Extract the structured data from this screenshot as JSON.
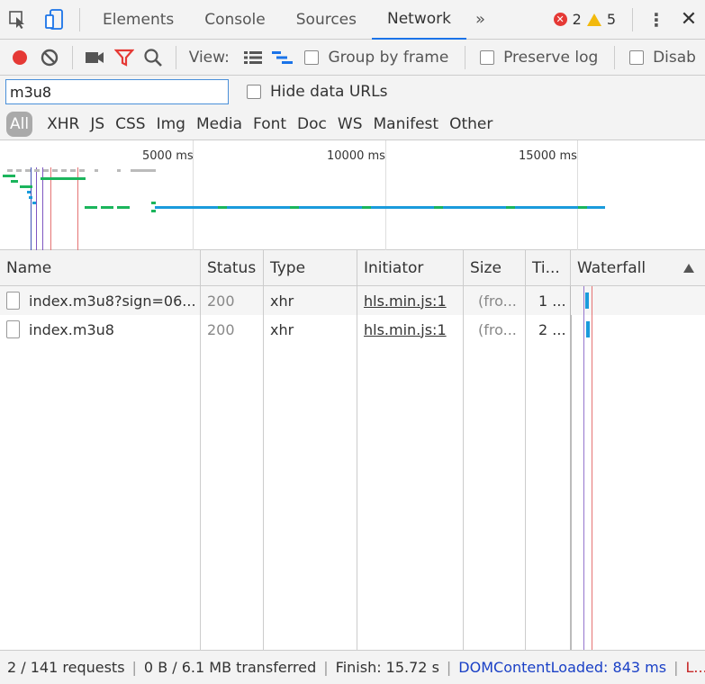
{
  "topbar": {
    "tabs": [
      "Elements",
      "Console",
      "Sources",
      "Network"
    ],
    "active_tab": "Network",
    "more_tabs": "»",
    "errors": "2",
    "warnings": "5",
    "more_menu": "⋮",
    "close": "✕"
  },
  "toolbar": {
    "view_label": "View:",
    "group_by_frame": "Group by frame",
    "preserve_log": "Preserve log",
    "disable_cache": "Disab"
  },
  "filter": {
    "value": "m3u8",
    "hide_data_urls": "Hide data URLs"
  },
  "types": [
    "All",
    "XHR",
    "JS",
    "CSS",
    "Img",
    "Media",
    "Font",
    "Doc",
    "WS",
    "Manifest",
    "Other"
  ],
  "active_type": "All",
  "overview": {
    "ticks": [
      "5000 ms",
      "10000 ms",
      "15000 ms"
    ]
  },
  "table": {
    "headers": [
      "Name",
      "Status",
      "Type",
      "Initiator",
      "Size",
      "Ti...",
      "Waterfall"
    ],
    "rows": [
      {
        "name": "index.m3u8?sign=06...",
        "status": "200",
        "type": "xhr",
        "initiator": "hls.min.js:1",
        "size": "(fro...",
        "time": "1 ..."
      },
      {
        "name": "index.m3u8",
        "status": "200",
        "type": "xhr",
        "initiator": "hls.min.js:1",
        "size": "(fro...",
        "time": "2 ..."
      }
    ]
  },
  "status": {
    "requests": "2 / 141 requests",
    "transferred": "0 B / 6.1 MB transferred",
    "finish": "Finish: 15.72 s",
    "dcl": "DOMContentLoaded: 843 ms",
    "load": "L..."
  },
  "colors": {
    "record": "#e53935",
    "filter_icon": "#e53935",
    "accent": "#1a73e8",
    "dcl_line": "#3f51b5",
    "load_line": "#e57373",
    "bar_blue": "#1a9bdc",
    "bar_green": "#1bb55c"
  }
}
